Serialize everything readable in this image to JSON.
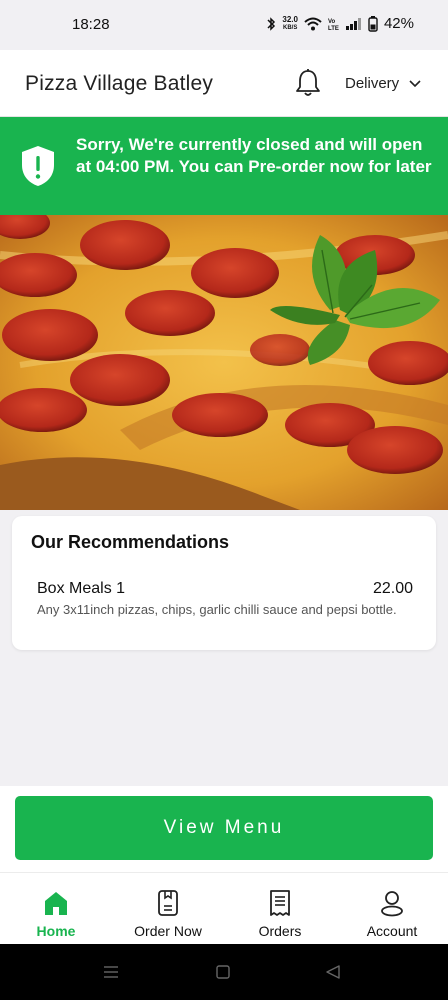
{
  "status_bar": {
    "time": "18:28",
    "net_speed_value": "32.0",
    "net_speed_unit": "KB/S",
    "battery": "42%"
  },
  "header": {
    "store_name": "Pizza Village Batley",
    "delivery_label": "Delivery"
  },
  "banner": {
    "message": "Sorry, We're currently closed and will open at 04:00 PM. You can Pre-order now for later"
  },
  "recommendations": {
    "title": "Our Recommendations",
    "items": [
      {
        "name": "Box Meals 1",
        "price": "22.00",
        "description": "Any 3x11inch pizzas, chips, garlic chilli sauce and pepsi bottle."
      }
    ]
  },
  "cta": {
    "view_menu_label": "View Menu"
  },
  "bottom_nav": {
    "items": [
      {
        "label": "Home",
        "icon": "home-icon",
        "active": true
      },
      {
        "label": "Order Now",
        "icon": "order-now-icon",
        "active": false
      },
      {
        "label": "Orders",
        "icon": "receipt-icon",
        "active": false
      },
      {
        "label": "Account",
        "icon": "user-icon",
        "active": false
      }
    ]
  },
  "colors": {
    "accent": "#19b44f",
    "background": "#f1f0f3"
  }
}
